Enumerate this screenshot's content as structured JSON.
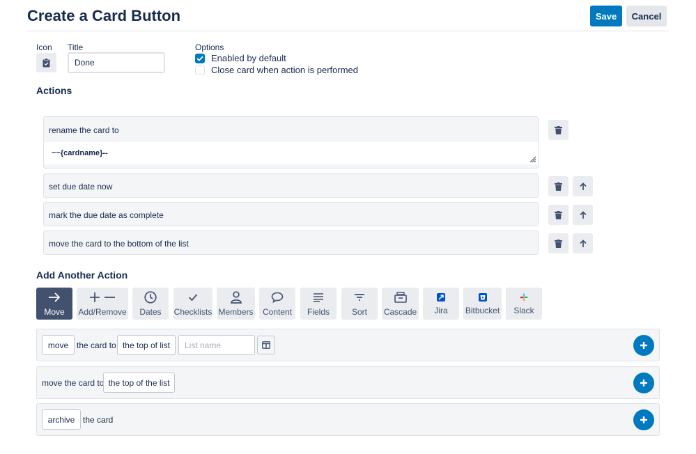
{
  "header": {
    "title": "Create a Card Button",
    "save_label": "Save",
    "cancel_label": "Cancel"
  },
  "form": {
    "icon_label": "Icon",
    "icon_name": "clipboard-check-icon",
    "title_label": "Title",
    "title_value": "Done",
    "options_label": "Options",
    "options": [
      {
        "label": "Enabled by default",
        "checked": true
      },
      {
        "label": "Close card when action is performed",
        "checked": false
      }
    ]
  },
  "actions": {
    "heading": "Actions",
    "items": [
      {
        "text": "rename the card to",
        "value": "~~{cardname}--"
      },
      {
        "text": "set due date now"
      },
      {
        "text": "mark the due date as complete"
      },
      {
        "text": "move the card to the bottom of the list"
      }
    ]
  },
  "add_action": {
    "heading": "Add Another Action",
    "tabs": [
      {
        "label": "Move",
        "icon": "arrow-right-icon",
        "active": true
      },
      {
        "label": "Add/Remove",
        "icon": "plus-minus-icon"
      },
      {
        "label": "Dates",
        "icon": "clock-icon"
      },
      {
        "label": "Checklists",
        "icon": "check-icon"
      },
      {
        "label": "Members",
        "icon": "person-icon"
      },
      {
        "label": "Content",
        "icon": "speech-bubble-icon"
      },
      {
        "label": "Fields",
        "icon": "lines-icon"
      },
      {
        "label": "Sort",
        "icon": "filter-icon"
      },
      {
        "label": "Cascade",
        "icon": "archive-box-icon"
      },
      {
        "label": "Jira",
        "icon": "jira-logo-icon"
      },
      {
        "label": "Bitbucket",
        "icon": "bitbucket-logo-icon"
      },
      {
        "label": "Slack",
        "icon": "slack-logo-icon"
      }
    ],
    "rules": [
      {
        "verb": "move",
        "text": "the card to",
        "target": "the top of list",
        "placeholder": "List name"
      },
      {
        "text": "move the card to",
        "target": "the top of the list"
      },
      {
        "verb": "archive",
        "text": "the card"
      }
    ]
  },
  "colors": {
    "accent": "#0079bf",
    "active_tab": "#42526e",
    "panel": "#f4f5f7"
  }
}
